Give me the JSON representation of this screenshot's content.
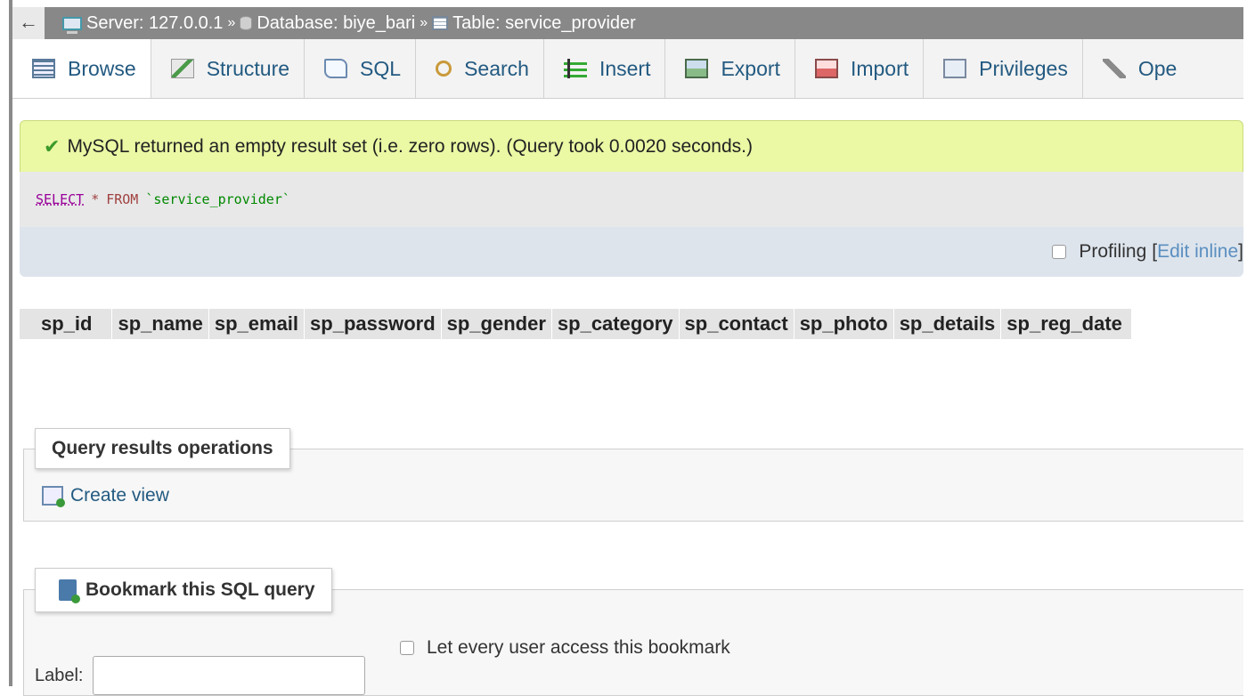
{
  "breadcrumb": {
    "back": "←",
    "server": "Server: 127.0.0.1",
    "database": "Database: biye_bari",
    "table": "Table: service_provider",
    "separator": "»"
  },
  "tabs": [
    {
      "label": "Browse",
      "icon": "browse-icon",
      "active": true
    },
    {
      "label": "Structure",
      "icon": "structure-icon"
    },
    {
      "label": "SQL",
      "icon": "sql-icon"
    },
    {
      "label": "Search",
      "icon": "search-icon"
    },
    {
      "label": "Insert",
      "icon": "insert-icon"
    },
    {
      "label": "Export",
      "icon": "export-icon"
    },
    {
      "label": "Import",
      "icon": "import-icon"
    },
    {
      "label": "Privileges",
      "icon": "privileges-icon"
    },
    {
      "label": "Ope",
      "icon": "wrench-icon"
    }
  ],
  "result": {
    "message": "MySQL returned an empty result set (i.e. zero rows). (Query took 0.0020 seconds.)",
    "accent": "#ebf8a4"
  },
  "query": {
    "keyword": "SELECT",
    "star": "*",
    "from": "FROM",
    "table": "`service_provider`"
  },
  "profiling": {
    "label": "Profiling",
    "bracket_open": "[",
    "edit_inline": "Edit inline",
    "bracket_close": "]"
  },
  "columns": [
    "sp_id",
    "sp_name",
    "sp_email",
    "sp_password",
    "sp_gender",
    "sp_category",
    "sp_contact",
    "sp_photo",
    "sp_details",
    "sp_reg_date"
  ],
  "query_ops": {
    "legend": "Query results operations",
    "create_view": "Create view"
  },
  "bookmark": {
    "legend": "Bookmark this SQL query",
    "label": "Label:",
    "label_value": "",
    "share": "Let every user access this bookmark"
  }
}
